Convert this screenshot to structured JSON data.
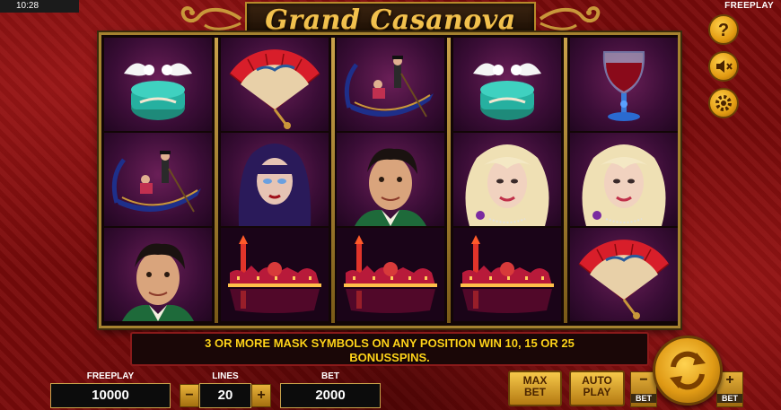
{
  "status_bar": {
    "clock": "10:28",
    "mode_label": "FREEPLAY"
  },
  "title": "Grand Casanova",
  "reels": [
    [
      "dove-box",
      "gondola",
      "man"
    ],
    [
      "fan",
      "dark-woman",
      "venice-skyline"
    ],
    [
      "gondola",
      "man",
      "venice-skyline"
    ],
    [
      "dove-box",
      "blonde-woman",
      "venice-skyline"
    ],
    [
      "wine-glass",
      "blonde-woman",
      "fan"
    ]
  ],
  "info_text_line1": "3 OR MORE MASK SYMBOLS ON ANY POSITION WIN 10, 15 OR 25",
  "info_text_line2": "BONUSSPINS.",
  "controls": {
    "freeplay_label": "FREEPLAY",
    "freeplay_value": "10000",
    "lines_label": "LINES",
    "lines_value": "20",
    "bet_label": "BET",
    "bet_value": "2000",
    "minus": "−",
    "plus": "+",
    "max_bet_line1": "MAX",
    "max_bet_line2": "BET",
    "auto_play_line1": "AUTO",
    "auto_play_line2": "PLAY",
    "bet_small_label": "BET"
  },
  "side_icons": [
    "help-icon",
    "sound-mute-icon",
    "settings-icon"
  ],
  "colors": {
    "background": "#7a0b0b",
    "gold": "#f2c14e",
    "info_text": "#ffd21a"
  }
}
